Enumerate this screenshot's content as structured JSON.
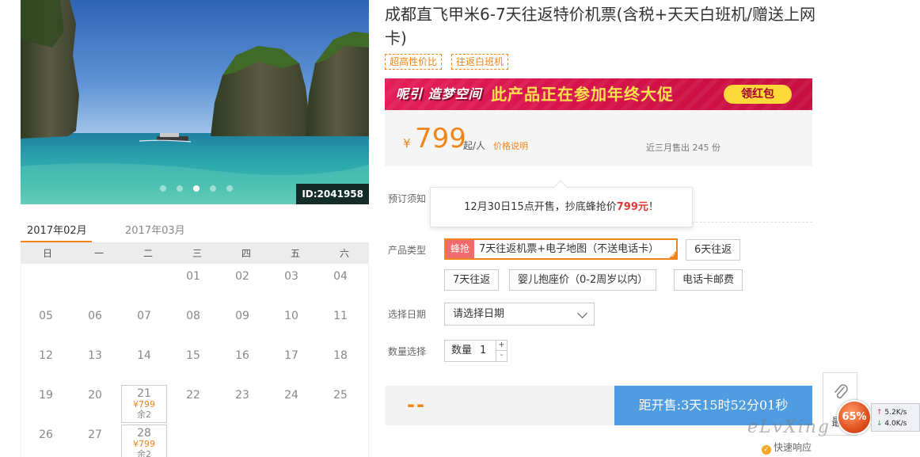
{
  "gallery": {
    "photo_id": "ID:2041958",
    "dot_count": 5,
    "active_dot": 2
  },
  "calendar": {
    "tabs": [
      "2017年02月",
      "2017年03月"
    ],
    "active_tab": 0,
    "weekdays": [
      "日",
      "一",
      "二",
      "三",
      "四",
      "五",
      "六"
    ],
    "weeks": [
      [
        "",
        "",
        "",
        "01",
        "02",
        "03",
        "04"
      ],
      [
        "05",
        "06",
        "07",
        "08",
        "09",
        "10",
        "11"
      ],
      [
        "12",
        "13",
        "14",
        "15",
        "16",
        "17",
        "18"
      ],
      [
        "19",
        "20",
        "21",
        "22",
        "23",
        "24",
        "25"
      ],
      [
        "26",
        "27",
        "28",
        "",
        "",
        "",
        ""
      ]
    ],
    "available": {
      "21": {
        "price": "¥799",
        "left": "余2"
      },
      "28": {
        "price": "¥799",
        "left": "余2"
      }
    }
  },
  "product": {
    "title": "成都直飞甲米6-7天往返特价机票(含税+天天白班机/赠送上网卡)",
    "tags": [
      "超高性价比",
      "往返白班机"
    ]
  },
  "banner": {
    "logo": "呢引 造梦空间",
    "text": "此产品正在参加年终大促",
    "button": "领红包"
  },
  "price": {
    "currency": "¥",
    "amount": "799",
    "unit": "起/人",
    "note": "价格说明",
    "sold": "近三月售出 245 份"
  },
  "booking": {
    "notice_label": "预订须知",
    "tooltip_prefix": "12月30日15点开售，抄底蜂抢价",
    "tooltip_price": "799元",
    "tooltip_suffix": "！",
    "type_label": "产品类型",
    "hot_badge": "蜂抢",
    "options": [
      "7天往返机票+电子地图（不送电话卡）",
      "6天往返",
      "7天往返",
      "婴儿抱座价（0-2周岁以内）",
      "电话卡邮费"
    ],
    "selected_option": 0,
    "date_label": "选择日期",
    "date_placeholder": "请选择日期",
    "qty_label": "数量选择",
    "qty_field_label": "数量",
    "qty_value": "1",
    "qty_plus": "+",
    "qty_minus": "-"
  },
  "bottom": {
    "price_placeholder": "--",
    "countdown": "距开售:3天15时52分01秒"
  },
  "widgets": {
    "speed_percent": "65%",
    "upload_speed": "5.2K/s",
    "download_speed": "4.0K/s",
    "watermark": "eLvXing",
    "fast_response": "快速响应",
    "side_char": "最"
  },
  "colors": {
    "accent": "#f08519",
    "countdown_bg": "#4f9de0",
    "banner_bg": "#d5124a",
    "banner_text": "#ffe34d",
    "hot_badge": "#f06b6b"
  }
}
